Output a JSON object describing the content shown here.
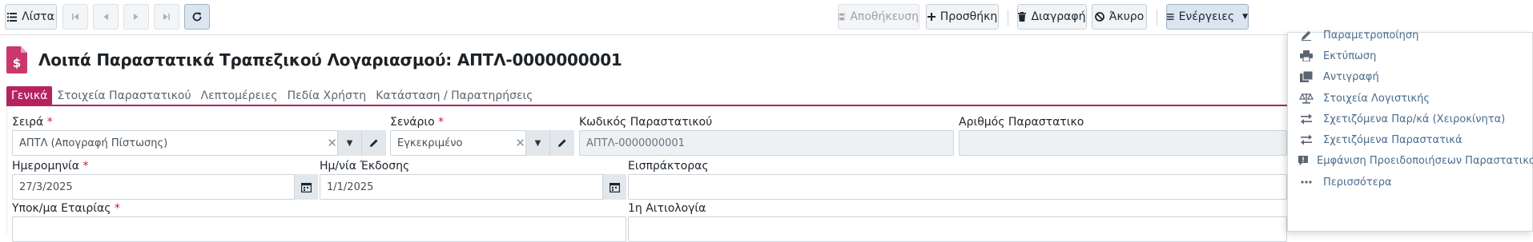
{
  "toolbar": {
    "list_label": "Λίστα",
    "save_label": "Αποθήκευση",
    "add_label": "Προσθήκη",
    "delete_label": "Διαγραφή",
    "cancel_label": "Άκυρο",
    "actions_label": "Ενέργειες"
  },
  "header": {
    "title": "Λοιπά Παραστατικά Τραπεζικού Λογαριασμού: ΑΠΤΛ-0000000001"
  },
  "tabs": [
    {
      "label": "Γενικά"
    },
    {
      "label": "Στοιχεία Παραστατικού"
    },
    {
      "label": "Λεπτομέρειες"
    },
    {
      "label": "Πεδία Χρήστη"
    },
    {
      "label": "Κατάσταση / Παρατηρήσεις"
    }
  ],
  "form": {
    "series_label": "Σειρά",
    "series_value": "ΑΠΤΛ (Απογραφή Πίστωσης)",
    "scenario_label": "Σενάριο",
    "scenario_value": "Εγκεκριμένο",
    "doc_code_label": "Κωδικός Παραστατικού",
    "doc_code_value": "ΑΠΤΛ-0000000001",
    "doc_number_label": "Αριθμός Παραστατικο",
    "date_label": "Ημερομηνία",
    "date_value": "27/3/2025",
    "issue_date_label": "Ημ/νία Έκδοσης",
    "issue_date_value": "1/1/2025",
    "collector_label": "Εισπράκτορας",
    "branch_label": "Υποκ/μα Εταιρίας",
    "reason_label": "1η Αιτιολογία",
    "required_mark": "*"
  },
  "actions_menu": {
    "items": [
      {
        "label": "Παραμετροποίηση",
        "icon": "pencil-icon"
      },
      {
        "label": "Εκτύπωση",
        "icon": "printer-icon"
      },
      {
        "label": "Αντιγραφή",
        "icon": "copy-icon"
      },
      {
        "label": "Στοιχεία Λογιστικής",
        "icon": "scale-icon"
      },
      {
        "label": "Σχετιζόμενα Παρ/κά (Χειροκίνητα)",
        "icon": "exchange-icon"
      },
      {
        "label": "Σχετιζόμενα Παραστατικά",
        "icon": "exchange-icon"
      },
      {
        "label": "Εμφάνιση Προειδοποιήσεων Παραστατικού",
        "icon": "alert-icon"
      },
      {
        "label": "Περισσότερα",
        "icon": "more-icon"
      }
    ]
  },
  "colors": {
    "accent": "#b5235f",
    "link": "#4a6b8c"
  }
}
